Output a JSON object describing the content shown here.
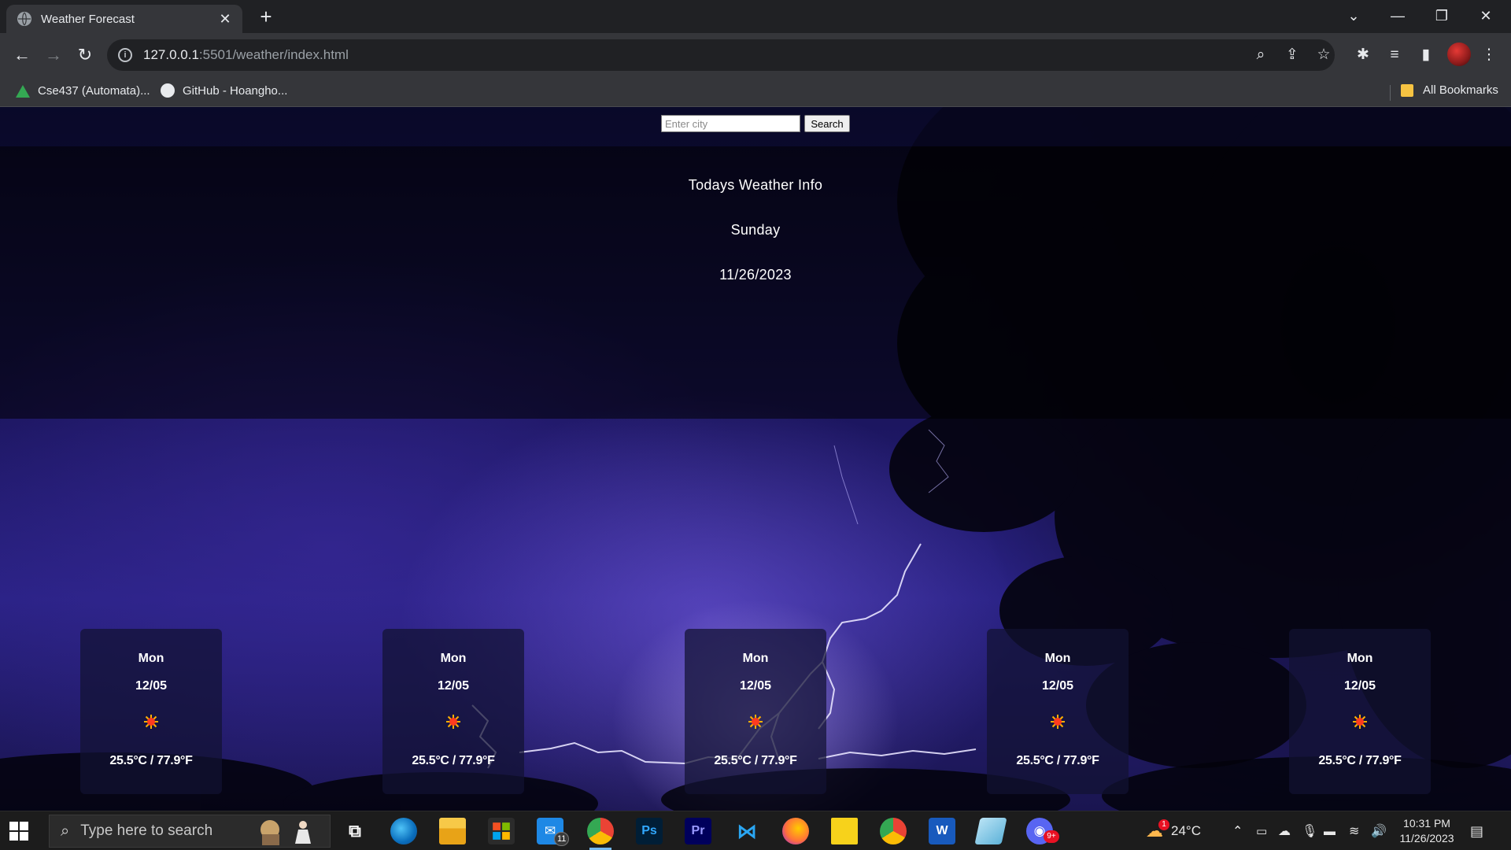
{
  "browser": {
    "tab_title": "Weather Forecast",
    "new_tab_symbol": "+",
    "url_host": "127.0.0.1",
    "url_path": ":5501/weather/index.html",
    "bookmarks": [
      {
        "label": "Cse437 (Automata)...",
        "icon": "google-drive-icon"
      },
      {
        "label": "GitHub - Hoangho...",
        "icon": "github-icon"
      }
    ],
    "all_bookmarks": "All Bookmarks"
  },
  "search": {
    "placeholder": "Enter city",
    "value": "",
    "button_label": "Search"
  },
  "today": {
    "heading": "Todays Weather Info",
    "day": "Sunday",
    "date": "11/26/2023"
  },
  "forecast": [
    {
      "day": "Mon",
      "date": "12/05",
      "icon": "sun-icon",
      "temp": "25.5°C / 77.9°F"
    },
    {
      "day": "Mon",
      "date": "12/05",
      "icon": "sun-icon",
      "temp": "25.5°C / 77.9°F"
    },
    {
      "day": "Mon",
      "date": "12/05",
      "icon": "sun-icon",
      "temp": "25.5°C / 77.9°F"
    },
    {
      "day": "Mon",
      "date": "12/05",
      "icon": "sun-icon",
      "temp": "25.5°C / 77.9°F"
    },
    {
      "day": "Mon",
      "date": "12/05",
      "icon": "sun-icon",
      "temp": "25.5°C / 77.9°F"
    }
  ],
  "taskbar": {
    "search_placeholder": "Type here to search",
    "mail_badge": "11",
    "discord_badge": "9+",
    "weather_temp": "24°C",
    "weather_badge": "1",
    "time": "10:31 PM",
    "date": "11/26/2023",
    "apps": [
      "task-view",
      "edge",
      "file-explorer",
      "microsoft-store",
      "mail",
      "chrome",
      "photoshop",
      "premiere",
      "vscode",
      "firefox",
      "sticky-notes",
      "chrome",
      "word",
      "notepad",
      "discord"
    ]
  },
  "colors": {
    "accent_underline": "#76b9ed",
    "card_bg": "rgba(18,18,50,0.72)",
    "sun_icon": "#ff3b1f"
  }
}
